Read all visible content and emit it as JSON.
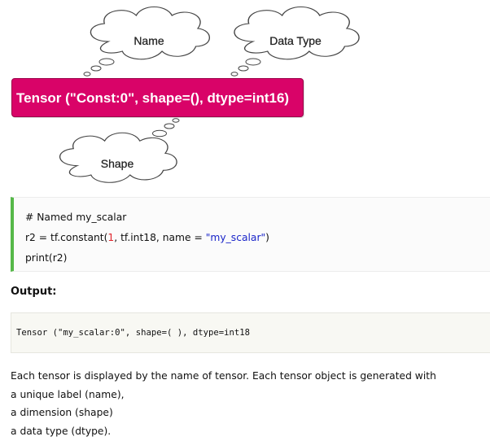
{
  "diagram": {
    "labels": {
      "name": "Name",
      "data_type": "Data Type",
      "shape": "Shape"
    },
    "tensor_text": "Tensor (\"Const:0\", shape=(), dtype=int16)",
    "colors": {
      "tensor_box": "#d90368",
      "cloud_fill": "#ffffff",
      "cloud_stroke": "#444444"
    }
  },
  "code": {
    "comment": "# Named my_scalar",
    "line2": {
      "prefix": "r2 = tf.constant(",
      "number": "1",
      "middle": ", tf.int18, name = ",
      "string": "\"my_scalar\"",
      "suffix": ")"
    },
    "line3": "print(r2)",
    "colors": {
      "border": "#56b849",
      "number": "#e0232b",
      "string": "#1a25c9"
    }
  },
  "output": {
    "heading": "Output:",
    "text": "Tensor (\"my_scalar:0\", shape=( ), dtype=int18"
  },
  "description": [
    "Each tensor is displayed by the name of tensor. Each tensor object is generated with",
    "a unique label (name),",
    "a dimension (shape)",
    "a data type (dtype)."
  ]
}
